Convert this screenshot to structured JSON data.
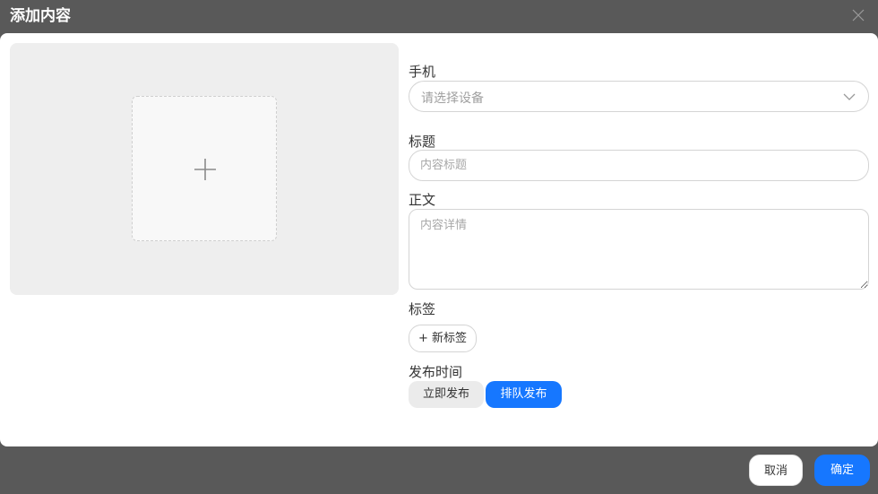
{
  "dialog": {
    "title": "添加内容"
  },
  "form": {
    "phone": {
      "label": "手机",
      "placeholder": "请选择设备"
    },
    "title": {
      "label": "标题",
      "placeholder": "内容标题",
      "value": ""
    },
    "body": {
      "label": "正文",
      "placeholder": "内容详情",
      "value": ""
    },
    "tags": {
      "label": "标签",
      "add_label": "+ 新标签"
    },
    "publish_time": {
      "label": "发布时间",
      "options": [
        "立即发布",
        "排队发布"
      ],
      "selected": "排队发布"
    }
  },
  "footer": {
    "cancel_label": "取消",
    "confirm_label": "确定"
  },
  "colors": {
    "accent": "#1677ff",
    "overlay": "#595959"
  },
  "icons": {
    "close": "close-icon",
    "upload": "plus-icon",
    "select": "chevron-down-icon"
  }
}
